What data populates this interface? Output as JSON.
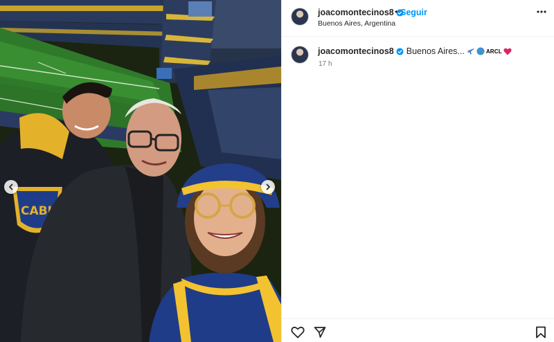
{
  "post": {
    "username": "joacomontecinos8",
    "separator": "•",
    "follow_label": "Seguir",
    "location": "Buenos Aires, Argentina",
    "caption_username": "joacomontecinos8",
    "caption_text": "Buenos Aires...",
    "caption_tag": "ARCL",
    "time_ago": "17 h"
  },
  "photo": {
    "description_icons": [
      "chevron-left-icon",
      "chevron-right-icon"
    ],
    "shirt_badge_text": "CABJ"
  },
  "actions": [
    "heart-icon",
    "share-icon",
    "bookmark-icon"
  ],
  "colors": {
    "follow": "#0095f6",
    "verified": "#0095f6",
    "heart": "#e0245e",
    "boca_blue": "#1f3c88",
    "boca_yellow": "#f2c230"
  }
}
